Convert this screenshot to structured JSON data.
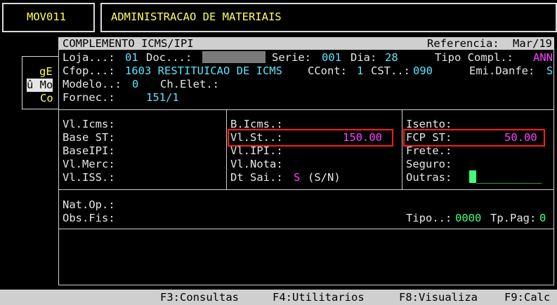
{
  "header": {
    "program_code": "MOV011",
    "system_title": "ADMINISTRACAO DE MATERIAIS"
  },
  "background_menu": {
    "item1": "gE",
    "item2": "û Mo",
    "item3": "Co"
  },
  "window": {
    "title": "COMPLEMENTO ICMS/IPI",
    "reference_label": "Referencia:",
    "reference_value": "Mar/19"
  },
  "doc": {
    "loja_label": "Loja...:",
    "loja_value": "01",
    "doc_label": "Doc...:",
    "serie_label": "Serie:",
    "serie_value": "001",
    "dia_label": "Dia:",
    "dia_value": "28",
    "tipo_compl_label": "Tipo Compl.:",
    "tipo_compl_value": "ANN",
    "cfop_label": "Cfop...:",
    "cfop_value": "1603 RESTITUICAO DE ICMS",
    "ccont_label": "CCont:",
    "ccont_value": "1",
    "cst_label": "CST..:",
    "cst_value": "090",
    "emi_danfe_label": "Emi.Danfe:",
    "emi_danfe_value": "S",
    "modelo_label": "Modelo..:",
    "modelo_value": "0",
    "ch_elet_label": "Ch.Elet.:",
    "fornec_label": "Fornec.:",
    "fornec_value": "151/1"
  },
  "values": {
    "col1": {
      "vl_icms": "Vl.Icms:",
      "base_st": "Base ST:",
      "base_ipi": "BaseIPI:",
      "vl_merc": "Vl.Merc:",
      "vl_iss": "Vl.ISS.:"
    },
    "col2": {
      "b_icms": "B.Icms.:",
      "vl_st_label": "Vl.St..:",
      "vl_st_value": "150.00",
      "vl_ipi": "Vl.IPI.:",
      "vl_nota": "Vl.Nota:",
      "dt_sai_label": "Dt Sai.:",
      "dt_sai_value": "S",
      "dt_sai_hint": "(S/N)"
    },
    "col3": {
      "isento": "Isento:",
      "fcp_st_label": "FCP ST:",
      "fcp_st_value": "50.00",
      "frete": "Frete.:",
      "seguro": "Seguro:",
      "outras_label": "Outras:",
      "outras_input": "__________"
    }
  },
  "fiscal": {
    "nat_op_label": "Nat.Op.:",
    "obs_fis_label": "Obs.Fis:",
    "tipo_label": "Tipo..:",
    "tipo_value": "0000",
    "tp_pag_label": "Tp.Pag:",
    "tp_pag_value": "0"
  },
  "function_keys": [
    {
      "label": "F3:Consultas"
    },
    {
      "label": "F4:Utilitarios"
    },
    {
      "label": "F8:Visualiza"
    },
    {
      "label": "F9:Calc"
    }
  ],
  "colors": {
    "background": "#000000",
    "label": "#e6e6e6",
    "header_text": "#ffff5a",
    "value_cyan": "#5ae6ff",
    "value_magenta": "#ff40ff",
    "cursor_green": "#40ff7a",
    "highlight_red": "#ff1a1a"
  }
}
